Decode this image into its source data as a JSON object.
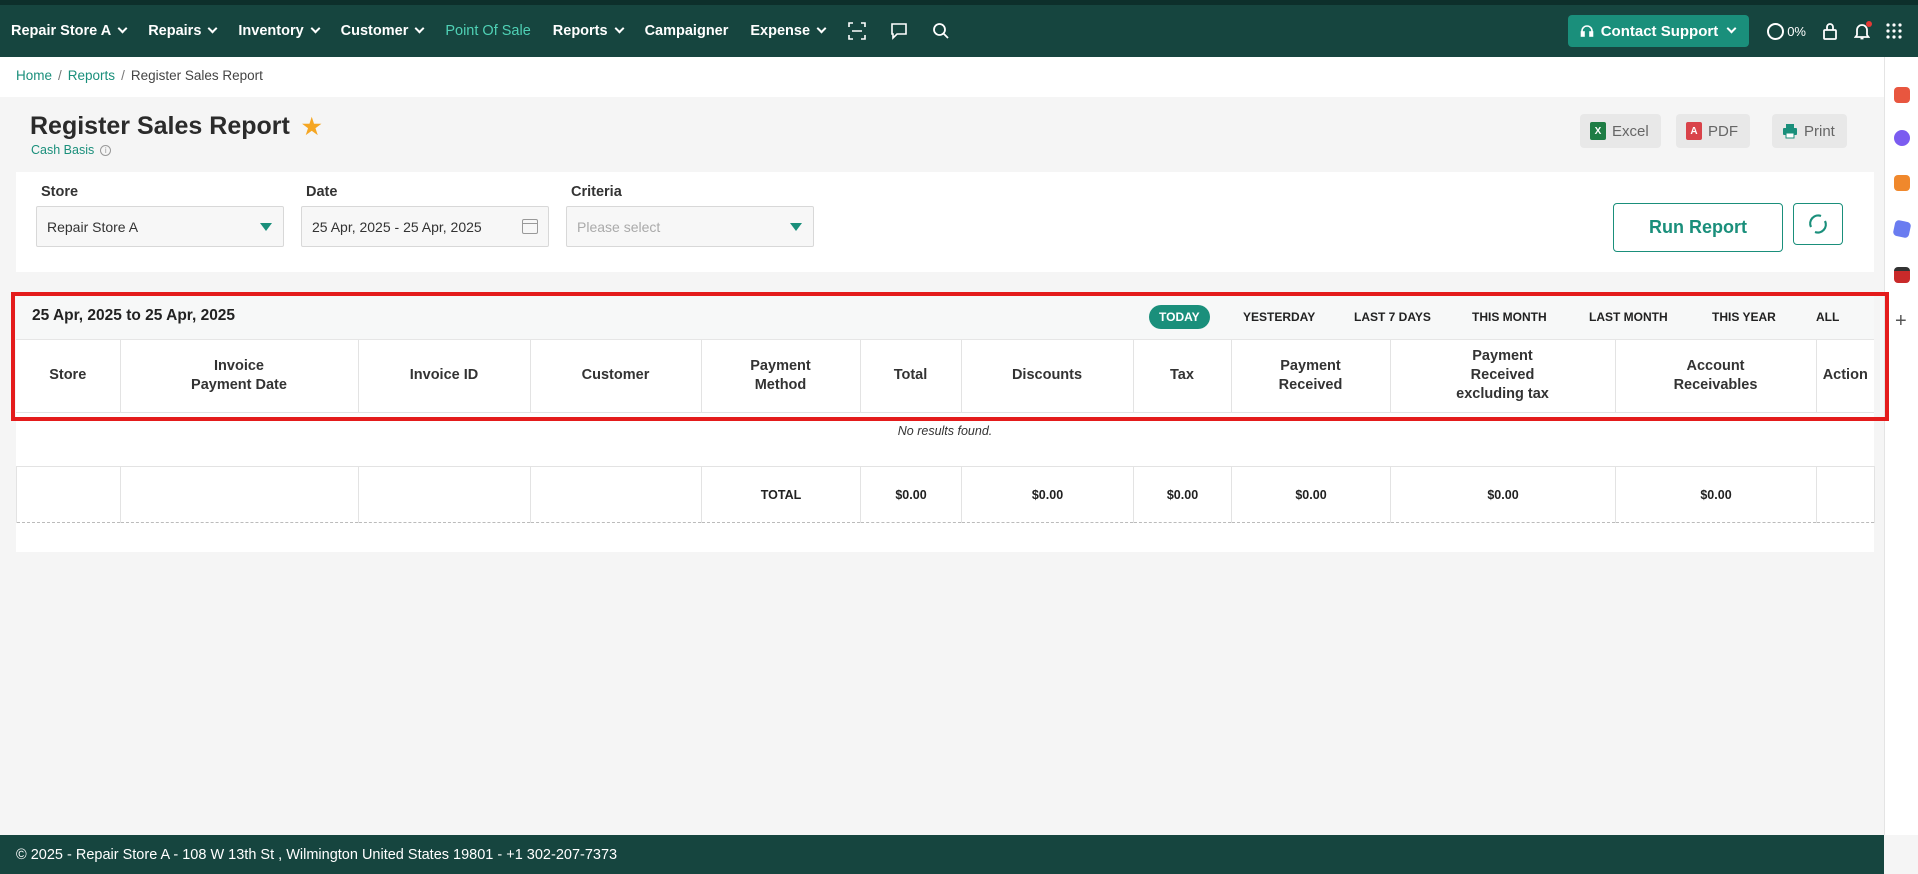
{
  "nav": {
    "items": [
      {
        "label": "Repair Store A",
        "dropdown": true
      },
      {
        "label": "Repairs",
        "dropdown": true
      },
      {
        "label": "Inventory",
        "dropdown": true
      },
      {
        "label": "Customer",
        "dropdown": true
      },
      {
        "label": "Point Of Sale",
        "dropdown": false,
        "active": true
      },
      {
        "label": "Reports",
        "dropdown": true
      },
      {
        "label": "Campaigner",
        "dropdown": false
      },
      {
        "label": "Expense",
        "dropdown": true
      }
    ],
    "icons": [
      "scan-icon",
      "chat-icon",
      "search-icon"
    ],
    "contact_support": "Contact Support",
    "progress_label": "0%",
    "right_icons": [
      "lock-icon",
      "bell-icon",
      "apps-grid-icon"
    ]
  },
  "breadcrumb": {
    "home": "Home",
    "reports": "Reports",
    "current": "Register Sales Report"
  },
  "page": {
    "title": "Register Sales Report",
    "subtitle": "Cash Basis"
  },
  "exports": {
    "excel": "Excel",
    "pdf": "PDF",
    "print": "Print"
  },
  "filters": {
    "store_label": "Store",
    "store_value": "Repair Store A",
    "date_label": "Date",
    "date_value": "25 Apr, 2025 - 25 Apr, 2025",
    "criteria_label": "Criteria",
    "criteria_placeholder": "Please select",
    "run_label": "Run Report"
  },
  "report": {
    "range": "25 Apr, 2025 to 25 Apr, 2025",
    "quick_filters": [
      "TODAY",
      "YESTERDAY",
      "LAST 7 DAYS",
      "THIS MONTH",
      "LAST MONTH",
      "THIS YEAR",
      "ALL"
    ],
    "columns": [
      "Store",
      "Invoice\nPayment Date",
      "Invoice ID",
      "Customer",
      "Payment\nMethod",
      "Total",
      "Discounts",
      "Tax",
      "Payment\nReceived",
      "Payment\nReceived\nexcluding tax",
      "Account\nReceivables",
      "Action"
    ],
    "no_results": "No results found.",
    "totals": [
      "",
      "",
      "",
      "",
      "TOTAL",
      "$0.00",
      "$0.00",
      "$0.00",
      "$0.00",
      "$0.00",
      "$0.00",
      ""
    ]
  },
  "footer": {
    "text": "© 2025 - Repair Store A - 108 W 13th St , Wilmington United States 19801 - +1 302-207-7373"
  },
  "colors": {
    "nav_bg": "#16453f",
    "accent": "#1a8f7b",
    "highlight": "#e41b1b",
    "star": "#f5a623"
  }
}
